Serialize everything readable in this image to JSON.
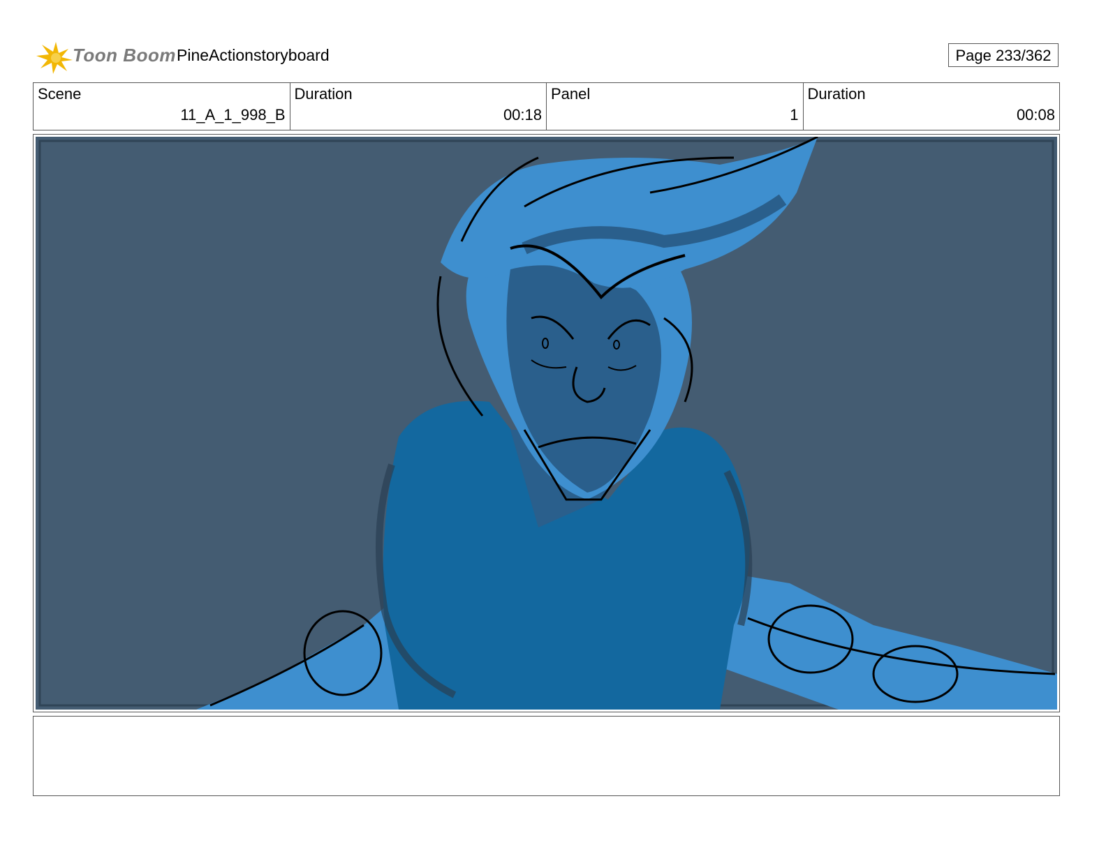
{
  "header": {
    "logo_text": "Toon Boom",
    "project_title": "PineActionstoryboard",
    "page_indicator": "Page 233/362"
  },
  "info": [
    {
      "label": "Scene",
      "value": "11_A_1_998_B"
    },
    {
      "label": "Duration",
      "value": "00:18"
    },
    {
      "label": "Panel",
      "value": "1"
    },
    {
      "label": "Duration",
      "value": "00:08"
    }
  ],
  "panel": {
    "image": "storyboard-sketch-character-closeup",
    "background_color": "#445c72",
    "figure_color": "#3e8fcf",
    "shadow_color": "#2a5f8c",
    "shirt_color": "#13689f"
  },
  "notes": {
    "text": ""
  }
}
